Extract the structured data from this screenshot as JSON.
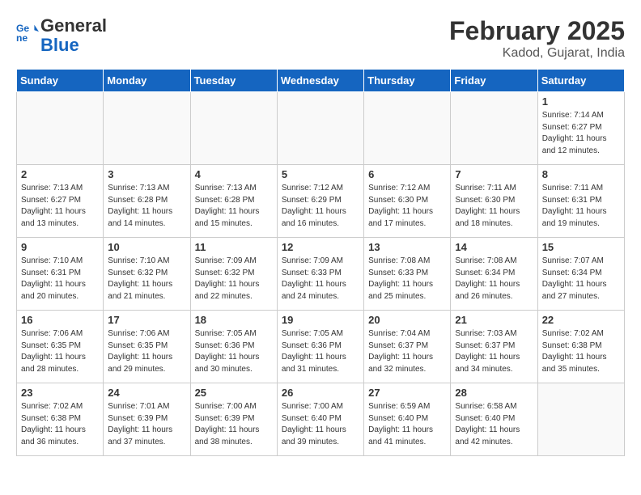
{
  "header": {
    "logo_line1": "General",
    "logo_line2": "Blue",
    "title": "February 2025",
    "subtitle": "Kadod, Gujarat, India"
  },
  "weekdays": [
    "Sunday",
    "Monday",
    "Tuesday",
    "Wednesday",
    "Thursday",
    "Friday",
    "Saturday"
  ],
  "weeks": [
    [
      {
        "day": "",
        "info": ""
      },
      {
        "day": "",
        "info": ""
      },
      {
        "day": "",
        "info": ""
      },
      {
        "day": "",
        "info": ""
      },
      {
        "day": "",
        "info": ""
      },
      {
        "day": "",
        "info": ""
      },
      {
        "day": "1",
        "info": "Sunrise: 7:14 AM\nSunset: 6:27 PM\nDaylight: 11 hours\nand 12 minutes."
      }
    ],
    [
      {
        "day": "2",
        "info": "Sunrise: 7:13 AM\nSunset: 6:27 PM\nDaylight: 11 hours\nand 13 minutes."
      },
      {
        "day": "3",
        "info": "Sunrise: 7:13 AM\nSunset: 6:28 PM\nDaylight: 11 hours\nand 14 minutes."
      },
      {
        "day": "4",
        "info": "Sunrise: 7:13 AM\nSunset: 6:28 PM\nDaylight: 11 hours\nand 15 minutes."
      },
      {
        "day": "5",
        "info": "Sunrise: 7:12 AM\nSunset: 6:29 PM\nDaylight: 11 hours\nand 16 minutes."
      },
      {
        "day": "6",
        "info": "Sunrise: 7:12 AM\nSunset: 6:30 PM\nDaylight: 11 hours\nand 17 minutes."
      },
      {
        "day": "7",
        "info": "Sunrise: 7:11 AM\nSunset: 6:30 PM\nDaylight: 11 hours\nand 18 minutes."
      },
      {
        "day": "8",
        "info": "Sunrise: 7:11 AM\nSunset: 6:31 PM\nDaylight: 11 hours\nand 19 minutes."
      }
    ],
    [
      {
        "day": "9",
        "info": "Sunrise: 7:10 AM\nSunset: 6:31 PM\nDaylight: 11 hours\nand 20 minutes."
      },
      {
        "day": "10",
        "info": "Sunrise: 7:10 AM\nSunset: 6:32 PM\nDaylight: 11 hours\nand 21 minutes."
      },
      {
        "day": "11",
        "info": "Sunrise: 7:09 AM\nSunset: 6:32 PM\nDaylight: 11 hours\nand 22 minutes."
      },
      {
        "day": "12",
        "info": "Sunrise: 7:09 AM\nSunset: 6:33 PM\nDaylight: 11 hours\nand 24 minutes."
      },
      {
        "day": "13",
        "info": "Sunrise: 7:08 AM\nSunset: 6:33 PM\nDaylight: 11 hours\nand 25 minutes."
      },
      {
        "day": "14",
        "info": "Sunrise: 7:08 AM\nSunset: 6:34 PM\nDaylight: 11 hours\nand 26 minutes."
      },
      {
        "day": "15",
        "info": "Sunrise: 7:07 AM\nSunset: 6:34 PM\nDaylight: 11 hours\nand 27 minutes."
      }
    ],
    [
      {
        "day": "16",
        "info": "Sunrise: 7:06 AM\nSunset: 6:35 PM\nDaylight: 11 hours\nand 28 minutes."
      },
      {
        "day": "17",
        "info": "Sunrise: 7:06 AM\nSunset: 6:35 PM\nDaylight: 11 hours\nand 29 minutes."
      },
      {
        "day": "18",
        "info": "Sunrise: 7:05 AM\nSunset: 6:36 PM\nDaylight: 11 hours\nand 30 minutes."
      },
      {
        "day": "19",
        "info": "Sunrise: 7:05 AM\nSunset: 6:36 PM\nDaylight: 11 hours\nand 31 minutes."
      },
      {
        "day": "20",
        "info": "Sunrise: 7:04 AM\nSunset: 6:37 PM\nDaylight: 11 hours\nand 32 minutes."
      },
      {
        "day": "21",
        "info": "Sunrise: 7:03 AM\nSunset: 6:37 PM\nDaylight: 11 hours\nand 34 minutes."
      },
      {
        "day": "22",
        "info": "Sunrise: 7:02 AM\nSunset: 6:38 PM\nDaylight: 11 hours\nand 35 minutes."
      }
    ],
    [
      {
        "day": "23",
        "info": "Sunrise: 7:02 AM\nSunset: 6:38 PM\nDaylight: 11 hours\nand 36 minutes."
      },
      {
        "day": "24",
        "info": "Sunrise: 7:01 AM\nSunset: 6:39 PM\nDaylight: 11 hours\nand 37 minutes."
      },
      {
        "day": "25",
        "info": "Sunrise: 7:00 AM\nSunset: 6:39 PM\nDaylight: 11 hours\nand 38 minutes."
      },
      {
        "day": "26",
        "info": "Sunrise: 7:00 AM\nSunset: 6:40 PM\nDaylight: 11 hours\nand 39 minutes."
      },
      {
        "day": "27",
        "info": "Sunrise: 6:59 AM\nSunset: 6:40 PM\nDaylight: 11 hours\nand 41 minutes."
      },
      {
        "day": "28",
        "info": "Sunrise: 6:58 AM\nSunset: 6:40 PM\nDaylight: 11 hours\nand 42 minutes."
      },
      {
        "day": "",
        "info": ""
      }
    ]
  ]
}
